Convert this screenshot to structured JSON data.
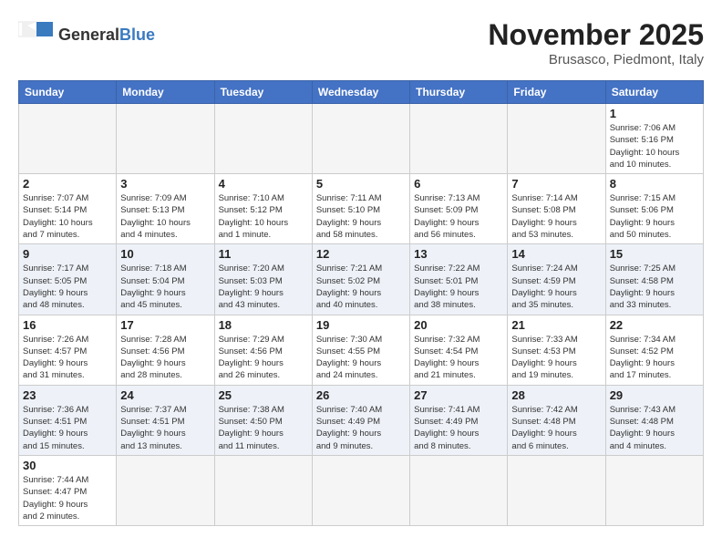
{
  "header": {
    "logo": {
      "general": "General",
      "blue": "Blue"
    },
    "title": "November 2025",
    "location": "Brusasco, Piedmont, Italy"
  },
  "weekdays": [
    "Sunday",
    "Monday",
    "Tuesday",
    "Wednesday",
    "Thursday",
    "Friday",
    "Saturday"
  ],
  "rows": [
    [
      {
        "day": "",
        "info": ""
      },
      {
        "day": "",
        "info": ""
      },
      {
        "day": "",
        "info": ""
      },
      {
        "day": "",
        "info": ""
      },
      {
        "day": "",
        "info": ""
      },
      {
        "day": "",
        "info": ""
      },
      {
        "day": "1",
        "info": "Sunrise: 7:06 AM\nSunset: 5:16 PM\nDaylight: 10 hours\nand 10 minutes."
      }
    ],
    [
      {
        "day": "2",
        "info": "Sunrise: 7:07 AM\nSunset: 5:14 PM\nDaylight: 10 hours\nand 7 minutes."
      },
      {
        "day": "3",
        "info": "Sunrise: 7:09 AM\nSunset: 5:13 PM\nDaylight: 10 hours\nand 4 minutes."
      },
      {
        "day": "4",
        "info": "Sunrise: 7:10 AM\nSunset: 5:12 PM\nDaylight: 10 hours\nand 1 minute."
      },
      {
        "day": "5",
        "info": "Sunrise: 7:11 AM\nSunset: 5:10 PM\nDaylight: 9 hours\nand 58 minutes."
      },
      {
        "day": "6",
        "info": "Sunrise: 7:13 AM\nSunset: 5:09 PM\nDaylight: 9 hours\nand 56 minutes."
      },
      {
        "day": "7",
        "info": "Sunrise: 7:14 AM\nSunset: 5:08 PM\nDaylight: 9 hours\nand 53 minutes."
      },
      {
        "day": "8",
        "info": "Sunrise: 7:15 AM\nSunset: 5:06 PM\nDaylight: 9 hours\nand 50 minutes."
      }
    ],
    [
      {
        "day": "9",
        "info": "Sunrise: 7:17 AM\nSunset: 5:05 PM\nDaylight: 9 hours\nand 48 minutes."
      },
      {
        "day": "10",
        "info": "Sunrise: 7:18 AM\nSunset: 5:04 PM\nDaylight: 9 hours\nand 45 minutes."
      },
      {
        "day": "11",
        "info": "Sunrise: 7:20 AM\nSunset: 5:03 PM\nDaylight: 9 hours\nand 43 minutes."
      },
      {
        "day": "12",
        "info": "Sunrise: 7:21 AM\nSunset: 5:02 PM\nDaylight: 9 hours\nand 40 minutes."
      },
      {
        "day": "13",
        "info": "Sunrise: 7:22 AM\nSunset: 5:01 PM\nDaylight: 9 hours\nand 38 minutes."
      },
      {
        "day": "14",
        "info": "Sunrise: 7:24 AM\nSunset: 4:59 PM\nDaylight: 9 hours\nand 35 minutes."
      },
      {
        "day": "15",
        "info": "Sunrise: 7:25 AM\nSunset: 4:58 PM\nDaylight: 9 hours\nand 33 minutes."
      }
    ],
    [
      {
        "day": "16",
        "info": "Sunrise: 7:26 AM\nSunset: 4:57 PM\nDaylight: 9 hours\nand 31 minutes."
      },
      {
        "day": "17",
        "info": "Sunrise: 7:28 AM\nSunset: 4:56 PM\nDaylight: 9 hours\nand 28 minutes."
      },
      {
        "day": "18",
        "info": "Sunrise: 7:29 AM\nSunset: 4:56 PM\nDaylight: 9 hours\nand 26 minutes."
      },
      {
        "day": "19",
        "info": "Sunrise: 7:30 AM\nSunset: 4:55 PM\nDaylight: 9 hours\nand 24 minutes."
      },
      {
        "day": "20",
        "info": "Sunrise: 7:32 AM\nSunset: 4:54 PM\nDaylight: 9 hours\nand 21 minutes."
      },
      {
        "day": "21",
        "info": "Sunrise: 7:33 AM\nSunset: 4:53 PM\nDaylight: 9 hours\nand 19 minutes."
      },
      {
        "day": "22",
        "info": "Sunrise: 7:34 AM\nSunset: 4:52 PM\nDaylight: 9 hours\nand 17 minutes."
      }
    ],
    [
      {
        "day": "23",
        "info": "Sunrise: 7:36 AM\nSunset: 4:51 PM\nDaylight: 9 hours\nand 15 minutes."
      },
      {
        "day": "24",
        "info": "Sunrise: 7:37 AM\nSunset: 4:51 PM\nDaylight: 9 hours\nand 13 minutes."
      },
      {
        "day": "25",
        "info": "Sunrise: 7:38 AM\nSunset: 4:50 PM\nDaylight: 9 hours\nand 11 minutes."
      },
      {
        "day": "26",
        "info": "Sunrise: 7:40 AM\nSunset: 4:49 PM\nDaylight: 9 hours\nand 9 minutes."
      },
      {
        "day": "27",
        "info": "Sunrise: 7:41 AM\nSunset: 4:49 PM\nDaylight: 9 hours\nand 8 minutes."
      },
      {
        "day": "28",
        "info": "Sunrise: 7:42 AM\nSunset: 4:48 PM\nDaylight: 9 hours\nand 6 minutes."
      },
      {
        "day": "29",
        "info": "Sunrise: 7:43 AM\nSunset: 4:48 PM\nDaylight: 9 hours\nand 4 minutes."
      }
    ],
    [
      {
        "day": "30",
        "info": "Sunrise: 7:44 AM\nSunset: 4:47 PM\nDaylight: 9 hours\nand 2 minutes."
      },
      {
        "day": "",
        "info": ""
      },
      {
        "day": "",
        "info": ""
      },
      {
        "day": "",
        "info": ""
      },
      {
        "day": "",
        "info": ""
      },
      {
        "day": "",
        "info": ""
      },
      {
        "day": "",
        "info": ""
      }
    ]
  ],
  "row_shades": [
    false,
    false,
    true,
    false,
    true,
    false
  ]
}
